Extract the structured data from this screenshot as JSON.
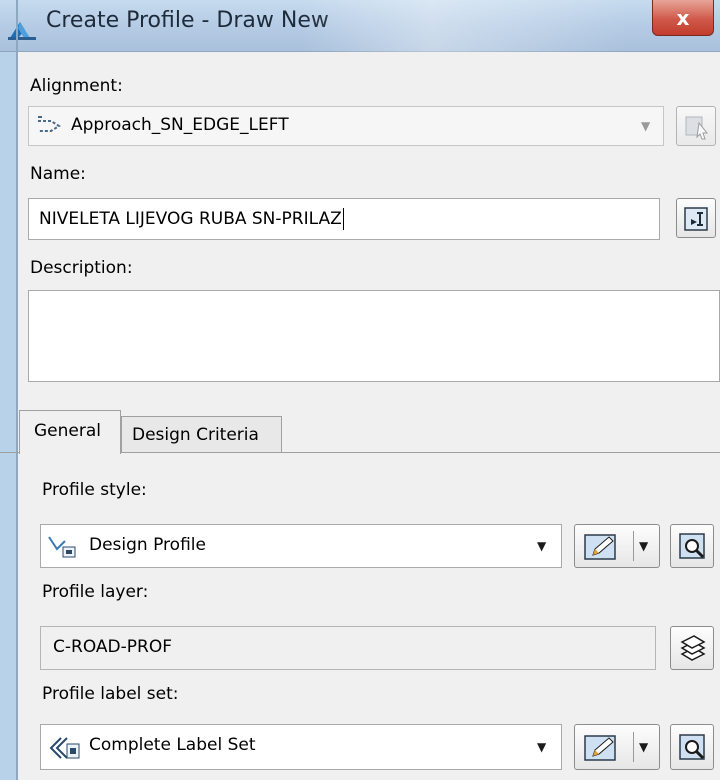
{
  "window": {
    "title": "Create Profile - Draw New",
    "close_symbol": "x"
  },
  "alignment": {
    "label": "Alignment:",
    "value": "Approach_SN_EDGE_LEFT",
    "dropdown_symbol": "▼"
  },
  "name": {
    "label": "Name:",
    "value": "NIVELETA LIJEVOG RUBA SN-PRILAZ"
  },
  "description": {
    "label": "Description:",
    "value": ""
  },
  "tabs": [
    {
      "label": "General",
      "active": true
    },
    {
      "label": "Design Criteria",
      "active": false
    }
  ],
  "profile_style": {
    "label": "Profile style:",
    "value": "Design Profile",
    "dropdown_symbol": "▼"
  },
  "profile_layer": {
    "label": "Profile layer:",
    "value": "C-ROAD-PROF"
  },
  "profile_label_set": {
    "label": "Profile label set:",
    "value": "Complete Label Set",
    "dropdown_symbol": "▼"
  },
  "icons": {
    "app": "civil3d-app-icon",
    "alignment": "alignment-icon",
    "pick_alignment": "pick-from-drawing-icon",
    "pick_name": "name-template-icon",
    "profile_style": "design-profile-icon",
    "edit": "edit-pencil-icon",
    "preview": "preview-magnifier-icon",
    "layer": "layer-stack-icon",
    "label_set": "label-set-icon"
  },
  "colors": {
    "title_bar": "#b7cde6",
    "close_button": "#c94a3a",
    "background": "#f0f0f0"
  }
}
